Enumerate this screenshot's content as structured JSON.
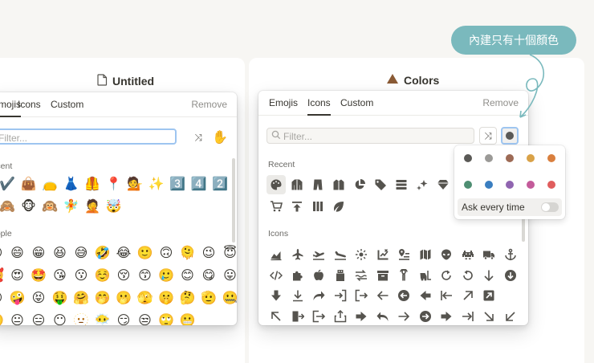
{
  "left_page": {
    "title": "Untitled",
    "tabs": [
      "Emojis",
      "Icons",
      "Custom"
    ],
    "remove_label": "Remove",
    "filter_placeholder": "Filter...",
    "recent_label": "Recent",
    "people_label": "People",
    "recent_emojis": [
      "✔️",
      "👜",
      "👝",
      "👗",
      "🦺",
      "📍",
      "💁",
      "✨",
      "3️⃣",
      "4️⃣",
      "2️⃣",
      "🙈",
      "🐵",
      "🙉",
      "🧚",
      "🤦",
      "🤯"
    ],
    "people_emojis": [
      "😃",
      "😄",
      "😁",
      "😆",
      "😅",
      "🤣",
      "😂",
      "🙂",
      "🙃",
      "🫠",
      "😉",
      "😇",
      "🥰",
      "😍",
      "🤩",
      "😘",
      "😗",
      "☺️",
      "😚",
      "😙",
      "🥲",
      "😊",
      "😋",
      "😛",
      "😜",
      "🤪",
      "😝",
      "🤑",
      "🤗",
      "🤭",
      "🫢",
      "🫣",
      "🤫",
      "🤔",
      "🫡",
      "🤐",
      "🤨",
      "😐",
      "😑",
      "😶",
      "🫥",
      "😶‍🌫️",
      "😏",
      "😒",
      "🙄",
      "😬"
    ]
  },
  "right_page": {
    "title": "Colors",
    "tabs": [
      "Emojis",
      "Icons",
      "Custom"
    ],
    "remove_label": "Remove",
    "filter_placeholder": "Filter...",
    "recent_label": "Recent",
    "icons_label": "Icons",
    "recent_icons": [
      "palette-icon",
      "jacket-icon",
      "pants-icon",
      "coat-icon",
      "pie-chart-icon",
      "tag-icon",
      "server-icon",
      "sparkles-icon",
      "diamond-icon",
      "cart-icon",
      "arrow-up-bar-icon",
      "columns-icon",
      "leaf-icon"
    ],
    "icon_grid": [
      [
        "chart-area-icon",
        "airplane-icon",
        "takeoff-icon",
        "landing-icon",
        "sun-sparkle-icon",
        "chart-cross-icon",
        "map-pin-list-icon",
        "map-icon",
        "alien-icon",
        "invader-icon",
        "truck-icon",
        "anchor-icon"
      ],
      [
        "code-icon",
        "puzzle-icon",
        "apple-icon",
        "usb-icon",
        "transfer-icon",
        "archive-icon",
        "ram-icon",
        "forklift-icon",
        "redo-icon",
        "undo-icon",
        "arrow-down-icon",
        "circle-arrow-down-icon"
      ],
      [
        "bold-down-icon",
        "download-icon",
        "curved-right-icon",
        "enter-icon",
        "login-icon",
        "arrow-left-icon",
        "circle-arrow-left-icon",
        "bold-left-icon",
        "left-bar-icon",
        "up-right-icon",
        "square-up-right-icon"
      ],
      [
        "up-left-icon",
        "exit-icon",
        "logout-icon",
        "share-icon",
        "bold-right-icon",
        "reply-icon",
        "arrow-right-icon",
        "circle-arrow-right-icon",
        "bold-right-2-icon",
        "right-bar-icon",
        "down-right-icon",
        "down-left-icon"
      ]
    ]
  },
  "color_palette": {
    "colors": [
      "#5a5956",
      "#9b9a97",
      "#9d6a55",
      "#d9a248",
      "#d97f3e",
      "#4e8e72",
      "#3a7ec0",
      "#9065b0",
      "#c35b9a",
      "#e05d5d"
    ],
    "ask_label": "Ask every time",
    "ask_enabled": false
  },
  "callout": {
    "text": "內建只有十個顏色"
  }
}
